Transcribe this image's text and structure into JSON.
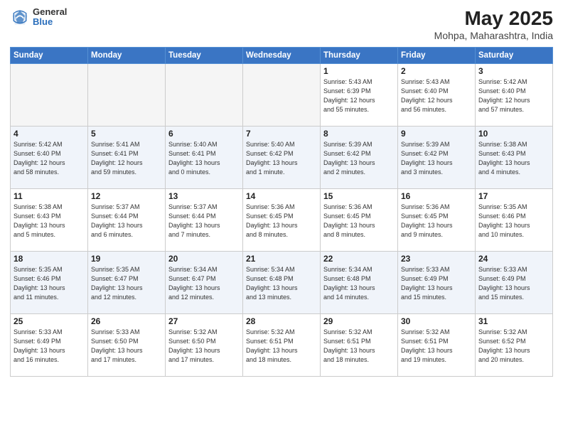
{
  "header": {
    "logo": {
      "general": "General",
      "blue": "Blue"
    },
    "title": "May 2025",
    "subtitle": "Mohpa, Maharashtra, India"
  },
  "days_of_week": [
    "Sunday",
    "Monday",
    "Tuesday",
    "Wednesday",
    "Thursday",
    "Friday",
    "Saturday"
  ],
  "weeks": [
    [
      {
        "day": "",
        "info": ""
      },
      {
        "day": "",
        "info": ""
      },
      {
        "day": "",
        "info": ""
      },
      {
        "day": "",
        "info": ""
      },
      {
        "day": "1",
        "info": "Sunrise: 5:43 AM\nSunset: 6:39 PM\nDaylight: 12 hours\nand 55 minutes."
      },
      {
        "day": "2",
        "info": "Sunrise: 5:43 AM\nSunset: 6:40 PM\nDaylight: 12 hours\nand 56 minutes."
      },
      {
        "day": "3",
        "info": "Sunrise: 5:42 AM\nSunset: 6:40 PM\nDaylight: 12 hours\nand 57 minutes."
      }
    ],
    [
      {
        "day": "4",
        "info": "Sunrise: 5:42 AM\nSunset: 6:40 PM\nDaylight: 12 hours\nand 58 minutes."
      },
      {
        "day": "5",
        "info": "Sunrise: 5:41 AM\nSunset: 6:41 PM\nDaylight: 12 hours\nand 59 minutes."
      },
      {
        "day": "6",
        "info": "Sunrise: 5:40 AM\nSunset: 6:41 PM\nDaylight: 13 hours\nand 0 minutes."
      },
      {
        "day": "7",
        "info": "Sunrise: 5:40 AM\nSunset: 6:42 PM\nDaylight: 13 hours\nand 1 minute."
      },
      {
        "day": "8",
        "info": "Sunrise: 5:39 AM\nSunset: 6:42 PM\nDaylight: 13 hours\nand 2 minutes."
      },
      {
        "day": "9",
        "info": "Sunrise: 5:39 AM\nSunset: 6:42 PM\nDaylight: 13 hours\nand 3 minutes."
      },
      {
        "day": "10",
        "info": "Sunrise: 5:38 AM\nSunset: 6:43 PM\nDaylight: 13 hours\nand 4 minutes."
      }
    ],
    [
      {
        "day": "11",
        "info": "Sunrise: 5:38 AM\nSunset: 6:43 PM\nDaylight: 13 hours\nand 5 minutes."
      },
      {
        "day": "12",
        "info": "Sunrise: 5:37 AM\nSunset: 6:44 PM\nDaylight: 13 hours\nand 6 minutes."
      },
      {
        "day": "13",
        "info": "Sunrise: 5:37 AM\nSunset: 6:44 PM\nDaylight: 13 hours\nand 7 minutes."
      },
      {
        "day": "14",
        "info": "Sunrise: 5:36 AM\nSunset: 6:45 PM\nDaylight: 13 hours\nand 8 minutes."
      },
      {
        "day": "15",
        "info": "Sunrise: 5:36 AM\nSunset: 6:45 PM\nDaylight: 13 hours\nand 8 minutes."
      },
      {
        "day": "16",
        "info": "Sunrise: 5:36 AM\nSunset: 6:45 PM\nDaylight: 13 hours\nand 9 minutes."
      },
      {
        "day": "17",
        "info": "Sunrise: 5:35 AM\nSunset: 6:46 PM\nDaylight: 13 hours\nand 10 minutes."
      }
    ],
    [
      {
        "day": "18",
        "info": "Sunrise: 5:35 AM\nSunset: 6:46 PM\nDaylight: 13 hours\nand 11 minutes."
      },
      {
        "day": "19",
        "info": "Sunrise: 5:35 AM\nSunset: 6:47 PM\nDaylight: 13 hours\nand 12 minutes."
      },
      {
        "day": "20",
        "info": "Sunrise: 5:34 AM\nSunset: 6:47 PM\nDaylight: 13 hours\nand 12 minutes."
      },
      {
        "day": "21",
        "info": "Sunrise: 5:34 AM\nSunset: 6:48 PM\nDaylight: 13 hours\nand 13 minutes."
      },
      {
        "day": "22",
        "info": "Sunrise: 5:34 AM\nSunset: 6:48 PM\nDaylight: 13 hours\nand 14 minutes."
      },
      {
        "day": "23",
        "info": "Sunrise: 5:33 AM\nSunset: 6:49 PM\nDaylight: 13 hours\nand 15 minutes."
      },
      {
        "day": "24",
        "info": "Sunrise: 5:33 AM\nSunset: 6:49 PM\nDaylight: 13 hours\nand 15 minutes."
      }
    ],
    [
      {
        "day": "25",
        "info": "Sunrise: 5:33 AM\nSunset: 6:49 PM\nDaylight: 13 hours\nand 16 minutes."
      },
      {
        "day": "26",
        "info": "Sunrise: 5:33 AM\nSunset: 6:50 PM\nDaylight: 13 hours\nand 17 minutes."
      },
      {
        "day": "27",
        "info": "Sunrise: 5:32 AM\nSunset: 6:50 PM\nDaylight: 13 hours\nand 17 minutes."
      },
      {
        "day": "28",
        "info": "Sunrise: 5:32 AM\nSunset: 6:51 PM\nDaylight: 13 hours\nand 18 minutes."
      },
      {
        "day": "29",
        "info": "Sunrise: 5:32 AM\nSunset: 6:51 PM\nDaylight: 13 hours\nand 18 minutes."
      },
      {
        "day": "30",
        "info": "Sunrise: 5:32 AM\nSunset: 6:51 PM\nDaylight: 13 hours\nand 19 minutes."
      },
      {
        "day": "31",
        "info": "Sunrise: 5:32 AM\nSunset: 6:52 PM\nDaylight: 13 hours\nand 20 minutes."
      }
    ]
  ]
}
